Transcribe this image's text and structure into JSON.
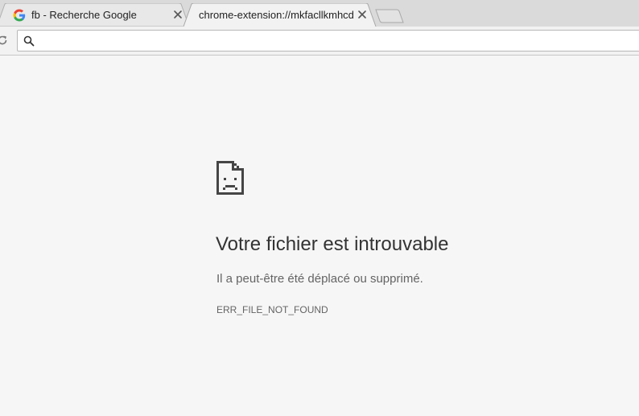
{
  "tabs": [
    {
      "title": "fb - Recherche Google",
      "favicon": "google-icon",
      "active": false
    },
    {
      "title": "chrome-extension://mkfacllkmhcd",
      "favicon": "",
      "active": true
    }
  ],
  "toolbar": {
    "address_value": "",
    "reload_icon": "reload-icon",
    "search_icon": "search-icon"
  },
  "error_page": {
    "icon": "sad-file-icon",
    "title": "Votre fichier est introuvable",
    "description": "Il a peut-être été déplacé ou supprimé.",
    "code": "ERR_FILE_NOT_FOUND"
  },
  "colors": {
    "page_background": "#f6f6f6",
    "tabstrip_background": "#dadada",
    "title_text": "#333333",
    "secondary_text": "#646464"
  }
}
